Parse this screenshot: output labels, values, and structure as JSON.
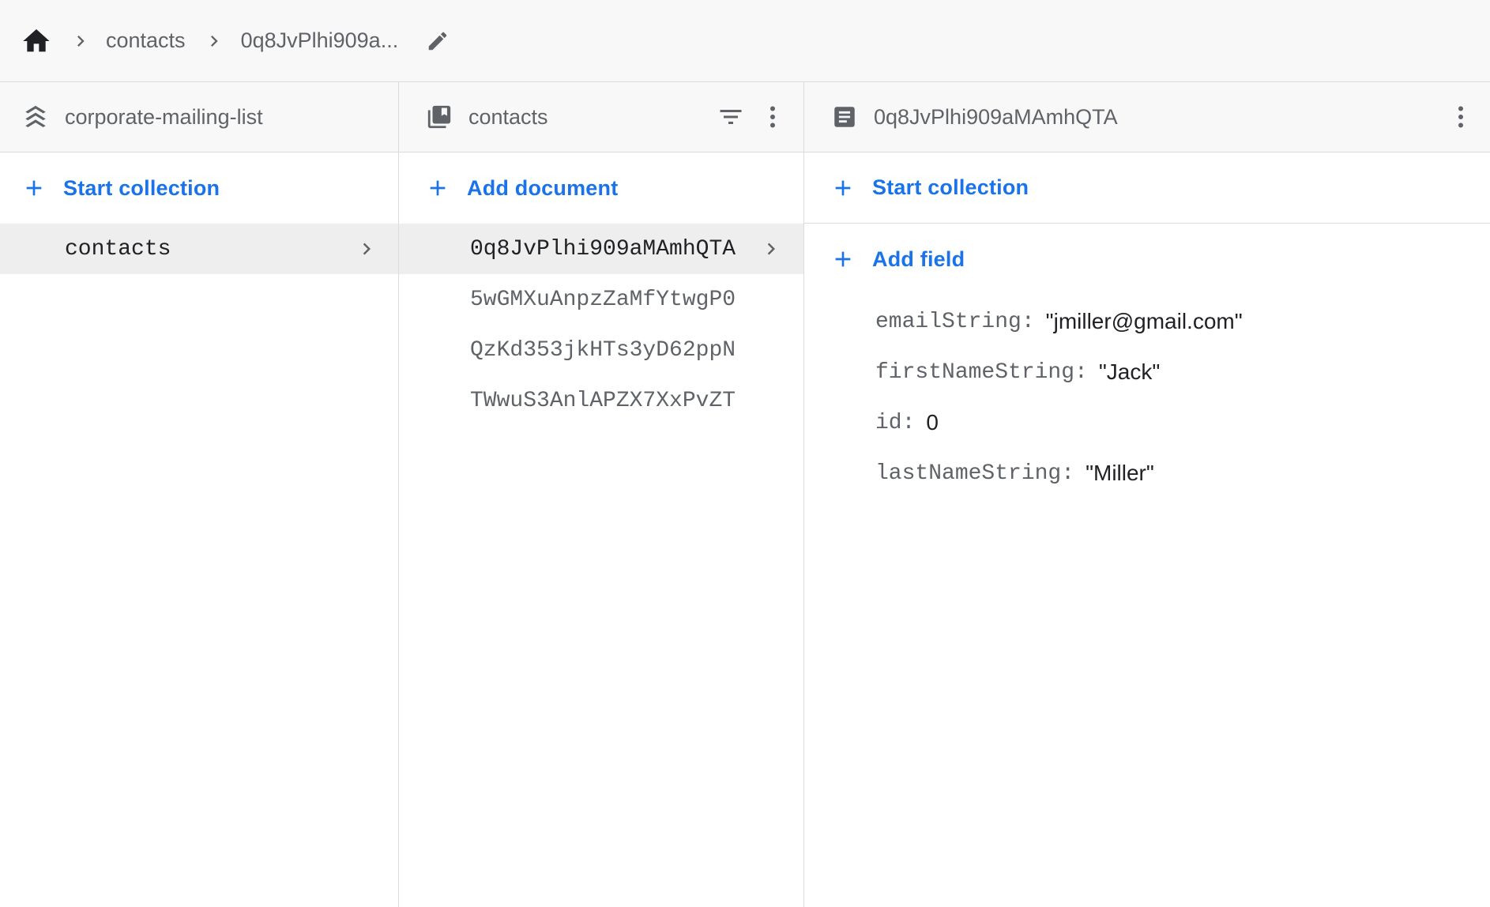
{
  "breadcrumb": {
    "home_icon": "home-icon",
    "items": [
      "contacts",
      "0q8JvPlhi909a..."
    ],
    "edit_icon": "pencil-icon"
  },
  "root_panel": {
    "title": "corporate-mailing-list",
    "icon": "firestore-stack-icon",
    "action_label": "Start collection",
    "items": [
      {
        "label": "contacts",
        "selected": true
      }
    ]
  },
  "collection_panel": {
    "title": "contacts",
    "icon": "collection-icon",
    "action_label": "Add document",
    "documents": [
      {
        "id": "0q8JvPlhi909aMAmhQTA",
        "selected": true
      },
      {
        "id": "5wGMXuAnpzZaMfYtwgP0",
        "selected": false
      },
      {
        "id": "QzKd353jkHTs3yD62ppN",
        "selected": false
      },
      {
        "id": "TWwuS3AnlAPZX7XxPvZT",
        "selected": false
      }
    ]
  },
  "document_panel": {
    "title": "0q8JvPlhi909aMAmhQTA",
    "icon": "document-icon",
    "start_collection_label": "Start collection",
    "add_field_label": "Add field",
    "fields": [
      {
        "key": "emailString",
        "value": "\"jmiller@gmail.com\""
      },
      {
        "key": "firstNameString",
        "value": "\"Jack\""
      },
      {
        "key": "id",
        "value": "0"
      },
      {
        "key": "lastNameString",
        "value": "\"Miller\""
      }
    ]
  },
  "colors": {
    "accent": "#1a73e8",
    "header_bg": "#f8f8f8",
    "selected_row_bg": "#eeeeee",
    "border": "#dadce0",
    "muted_text": "#5f6368"
  }
}
